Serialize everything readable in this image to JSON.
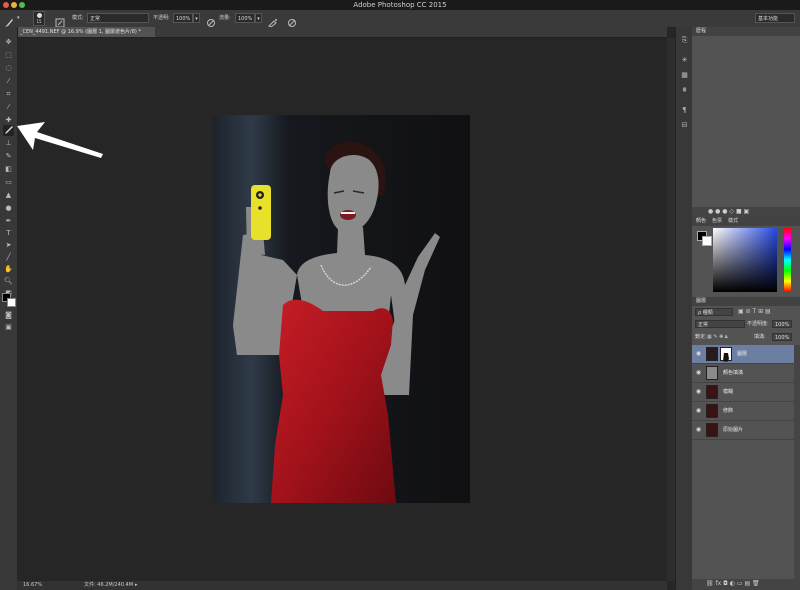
{
  "app": {
    "window_title": "Adobe Photoshop CC 2015"
  },
  "options": {
    "mode_label": "模式:",
    "mode_value": "正常",
    "opacity_label": "不透明:",
    "opacity_value": "100%",
    "flow_label": "流量:",
    "flow_value": "100%",
    "brush_size": "15",
    "workspace": "基本功能"
  },
  "document": {
    "tab_label": "_CEN_4491.NEF @ 16.9% (圖層 1, 圖層遮色片/8) *"
  },
  "status": {
    "zoom": "16.67%",
    "file_info": "文件: 46.2M/240.4M"
  },
  "panels": {
    "top_tab": "歷程",
    "color_tabs": [
      "顏色",
      "色票",
      "樣式"
    ],
    "layers_tab": "圖層",
    "kind_filter": "ρ 種類",
    "blend_mode": "正常",
    "opacity_label": "不透明度:",
    "opacity_value": "100%",
    "lock_label": "鎖定:",
    "fill_label": "填滿:",
    "fill_value": "100%"
  },
  "layers": [
    {
      "name": "圖層",
      "selected": true
    },
    {
      "name": "顏色填滿",
      "selected": false
    },
    {
      "name": "模糊",
      "selected": false
    },
    {
      "name": "修飾",
      "selected": false
    },
    {
      "name": "原始圖片",
      "selected": false
    }
  ],
  "icons": {
    "brush": "brush-icon",
    "eye": "eye-icon",
    "arrow": "arrow-annotation"
  },
  "colors": {
    "accent": "#6c7fa3",
    "dress": "#a8131c",
    "phone": "#e8e12a",
    "mask_gray": "#8a8a8a"
  }
}
